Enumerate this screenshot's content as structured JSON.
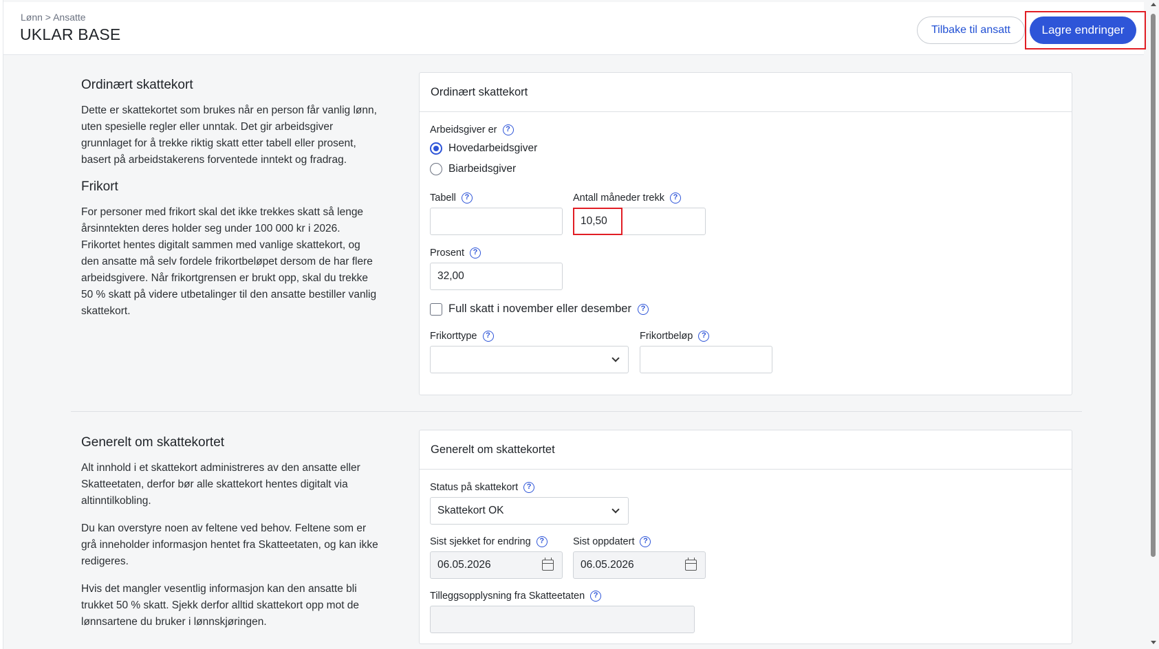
{
  "breadcrumb": "Lønn > Ansatte",
  "page_title": "UKLAR BASE",
  "buttons": {
    "back": "Tilbake til ansatt",
    "save": "Lagre endringer"
  },
  "colors": {
    "primary": "#2e55d8",
    "highlight": "#e11d24"
  },
  "section1": {
    "info_title_1": "Ordinært skattekort",
    "info_text_1": "Dette er skattekortet som brukes når en person får vanlig lønn, uten spesielle regler eller unntak. Det gir arbeidsgiver grunnlaget for å trekke riktig skatt etter tabell eller prosent, basert på arbeidstakerens forventede inntekt og fradrag.",
    "info_title_2": "Frikort",
    "info_text_2": "For personer med frikort skal det ikke trekkes skatt så lenge årsinntekten deres holder seg under 100 000 kr i 2026. Frikortet hentes digitalt sammen med vanlige skattekort, og den ansatte må selv fordele frikortbeløpet dersom de har flere arbeidsgivere. Når frikortgrensen er brukt opp, skal du trekke 50 % skatt på videre utbetalinger til den ansatte bestiller vanlig skattekort.",
    "card_title": "Ordinært skattekort",
    "employer_label": "Arbeidsgiver er",
    "employer_options": [
      "Hovedarbeidsgiver",
      "Biarbeidsgiver"
    ],
    "employer_selected": "Hovedarbeidsgiver",
    "tabell_label": "Tabell",
    "tabell_value": "",
    "months_label": "Antall måneder trekk",
    "months_value": "10,50",
    "percent_label": "Prosent",
    "percent_value": "32,00",
    "full_tax_label": "Full skatt i november eller desember",
    "frikort_type_label": "Frikorttype",
    "frikort_type_value": "",
    "frikort_amount_label": "Frikortbeløp",
    "frikort_amount_value": ""
  },
  "section2": {
    "info_title": "Generelt om skattekortet",
    "info_text_1": "Alt innhold i et skattekort administreres av den ansatte eller Skatteetaten, derfor bør alle skattekort hentes digitalt via altinntilkobling.",
    "info_text_2": "Du kan overstyre noen av feltene ved behov. Feltene som er grå inneholder informasjon hentet fra Skatteetaten, og kan ikke redigeres.",
    "info_text_3": "Hvis det mangler vesentlig informasjon kan den ansatte bli trukket 50 % skatt. Sjekk derfor alltid skattekort opp mot de lønnsartene du bruker i lønnskjøringen.",
    "card_title": "Generelt om skattekortet",
    "status_label": "Status på skattekort",
    "status_value": "Skattekort OK",
    "checked_label": "Sist sjekket for endring",
    "checked_value": "06.05.2026",
    "updated_label": "Sist oppdatert",
    "updated_value": "06.05.2026",
    "extra_label": "Tilleggsopplysning fra Skatteetaten",
    "extra_value": ""
  }
}
